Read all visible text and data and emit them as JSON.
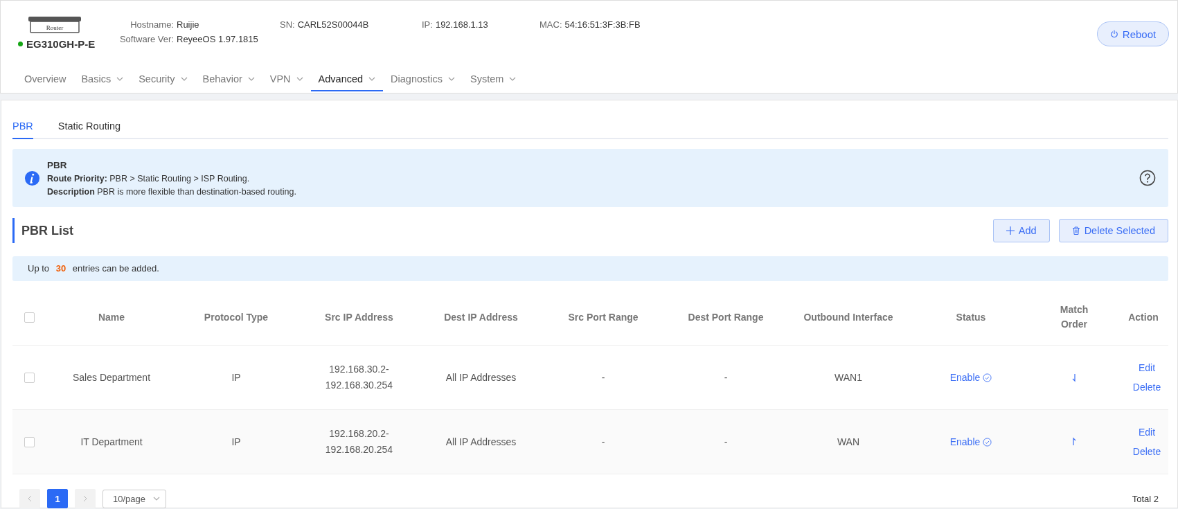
{
  "device": {
    "image_label": "Router",
    "model": "EG310GH-P-E",
    "online": true,
    "info": [
      {
        "label": "Hostname:",
        "value": "Ruijie"
      },
      {
        "label": "SN:",
        "value": "CARL52S00044B"
      },
      {
        "label": "IP:",
        "value": "192.168.1.13"
      },
      {
        "label": "MAC:",
        "value": "54:16:51:3F:3B:FB"
      },
      {
        "label": "Software Ver:",
        "value": "ReyeeOS 1.97.1815"
      }
    ],
    "reboot": "Reboot"
  },
  "nav": [
    {
      "label": "Overview",
      "dropdown": false,
      "selected": false
    },
    {
      "label": "Basics",
      "dropdown": true,
      "selected": false
    },
    {
      "label": "Security",
      "dropdown": true,
      "selected": false
    },
    {
      "label": "Behavior",
      "dropdown": true,
      "selected": false
    },
    {
      "label": "VPN",
      "dropdown": true,
      "selected": false
    },
    {
      "label": "Advanced",
      "dropdown": true,
      "selected": true
    },
    {
      "label": "Diagnostics",
      "dropdown": true,
      "selected": false
    },
    {
      "label": "System",
      "dropdown": true,
      "selected": false
    }
  ],
  "tabs": [
    {
      "label": "PBR",
      "selected": true
    },
    {
      "label": "Static Routing",
      "selected": false
    }
  ],
  "info_box": {
    "title": "PBR",
    "lines": [
      "**Route Priority:** PBR > Static Routing > ISP Routing.",
      "**Description** PBR is more flexible than destination-based routing."
    ]
  },
  "section": {
    "title": "PBR List",
    "buttons": [
      {
        "kind": "add",
        "label": "Add"
      },
      {
        "kind": "delete",
        "label": "Delete Selected"
      }
    ],
    "note": "Up to **30** entries can be added."
  },
  "table": {
    "header_checked": false,
    "columns": [
      "Name",
      "Protocol Type",
      "Src IP Address",
      "Dest IP Address",
      "Src Port Range",
      "Dest Port Range",
      "Outbound Interface",
      "Status",
      "Match Order",
      "Action"
    ],
    "rows": [
      {
        "checked": false,
        "name": "Sales Department",
        "protocol": "IP",
        "src_ip": [
          "192.168.30.2-",
          "192.168.30.254"
        ],
        "dest_ip": "All IP Addresses",
        "src_port": "-",
        "dest_port": "-",
        "outbound": "WAN1",
        "status": "Enable",
        "order_arrow_down": true,
        "actions": [
          "Edit",
          "Delete"
        ]
      },
      {
        "checked": false,
        "name": "IT Department",
        "protocol": "IP",
        "src_ip": [
          "192.168.20.2-",
          "192.168.20.254"
        ],
        "dest_ip": "All IP Addresses",
        "src_port": "-",
        "dest_port": "-",
        "outbound": "WAN",
        "status": "Enable",
        "order_arrow_down": false,
        "actions": [
          "Edit",
          "Delete"
        ]
      }
    ]
  },
  "pagination": {
    "pages": [
      {
        "label": "1",
        "selected": true
      }
    ],
    "page_size": "10/page",
    "total": "Total 2"
  }
}
